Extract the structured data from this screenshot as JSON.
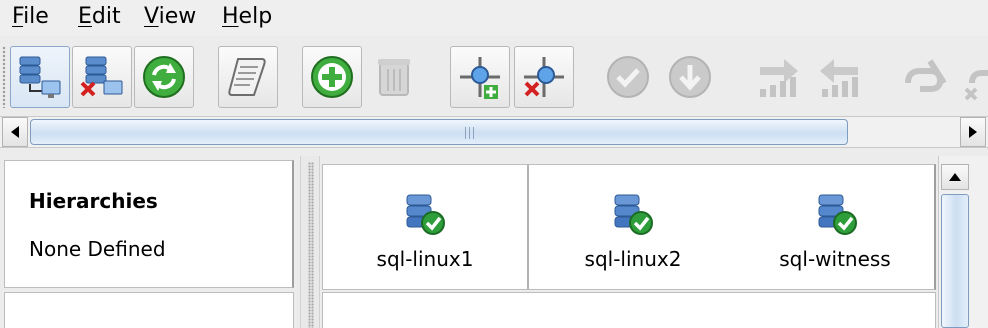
{
  "menu": [
    {
      "mnemonic": "F",
      "rest": "ile"
    },
    {
      "mnemonic": "E",
      "rest": "dit"
    },
    {
      "mnemonic": "V",
      "rest": "iew"
    },
    {
      "mnemonic": "H",
      "rest": "elp"
    }
  ],
  "toolbar": {
    "buttons": [
      {
        "icon": "connect-server-icon",
        "enabled": true
      },
      {
        "icon": "disconnect-server-icon",
        "enabled": true
      },
      {
        "icon": "refresh-icon",
        "enabled": true
      },
      {
        "icon": "log-scroll-icon",
        "enabled": true
      },
      {
        "icon": "add-green-plus-icon",
        "enabled": true
      },
      {
        "icon": "delete-trash-icon",
        "enabled": false
      },
      {
        "icon": "create-comm-path-icon",
        "enabled": true
      },
      {
        "icon": "delete-comm-path-icon",
        "enabled": true
      },
      {
        "icon": "in-service-check-icon",
        "enabled": false
      },
      {
        "icon": "out-of-service-icon",
        "enabled": false
      },
      {
        "icon": "extend-hierarchy-icon",
        "enabled": false
      },
      {
        "icon": "unextend-hierarchy-icon",
        "enabled": false
      },
      {
        "icon": "create-dependency-icon",
        "enabled": false
      },
      {
        "icon": "delete-dependency-icon",
        "enabled": false
      }
    ]
  },
  "hierarchies": {
    "title": "Hierarchies",
    "value": "None Defined"
  },
  "servers": [
    {
      "name": "sql-linux1",
      "status": "alive",
      "icon": "server-online-icon"
    },
    {
      "name": "sql-linux2",
      "status": "alive",
      "icon": "server-online-icon"
    },
    {
      "name": "sql-witness",
      "status": "alive",
      "icon": "server-online-icon"
    }
  ],
  "colors": {
    "ok_green": "#2e9e3a",
    "server_blue": "#4f7fbf",
    "disabled_gray": "#c4c4c4",
    "scroll_blue": "#cddff2"
  }
}
